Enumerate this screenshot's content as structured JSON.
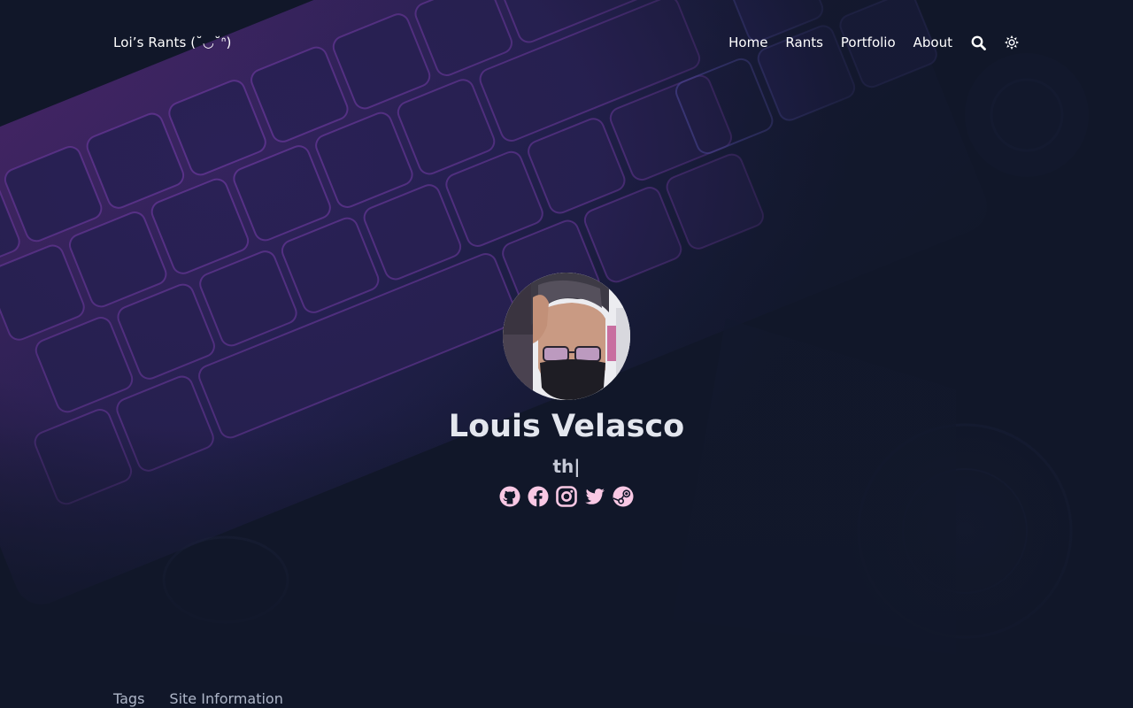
{
  "brand": {
    "title": "Loi’s Rants  (˘◡˘ᐢ)"
  },
  "nav": {
    "items": [
      {
        "label": "Home"
      },
      {
        "label": "Rants"
      },
      {
        "label": "Portfolio"
      },
      {
        "label": "About"
      }
    ],
    "search_icon": "search-icon",
    "theme_icon": "sun-icon"
  },
  "profile": {
    "name": "Louis Velasco",
    "subtitle": "th|",
    "socials": [
      "github-icon",
      "facebook-icon",
      "instagram-icon",
      "twitter-icon",
      "steam-icon"
    ]
  },
  "footer": {
    "links": [
      {
        "label": "Tags"
      },
      {
        "label": "Site Information"
      }
    ]
  },
  "colors": {
    "background": "#111729",
    "text": "#ffffff",
    "name": "#e3e6ee",
    "social_icon": "#f9c8e4",
    "footer_link": "#aeb6c8"
  }
}
